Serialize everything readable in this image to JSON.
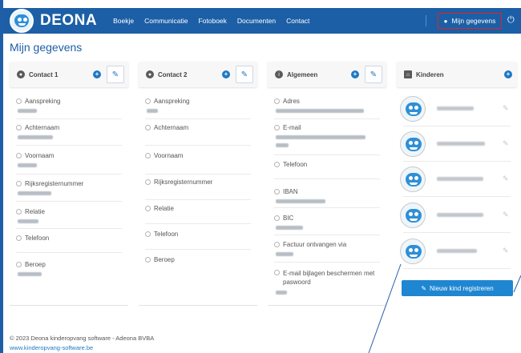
{
  "brand": "DEONA",
  "nav": {
    "links": [
      "Boekje",
      "Communicatie",
      "Fotoboek",
      "Documenten",
      "Contact"
    ],
    "user_label": "Mijn gegevens"
  },
  "page_title": "Mijn gegevens",
  "cards": {
    "contact1": {
      "title": "Contact 1",
      "fields": [
        "Aanspreking",
        "Achternaam",
        "Voornaam",
        "Rijksregisternummer",
        "Relatie",
        "Telefoon",
        "Beroep"
      ]
    },
    "contact2": {
      "title": "Contact 2",
      "fields": [
        "Aanspreking",
        "Achternaam",
        "Voornaam",
        "Rijksregisternummer",
        "Relatie",
        "Telefoon",
        "Beroep"
      ]
    },
    "algemeen": {
      "title": "Algemeen",
      "fields": [
        "Adres",
        "E-mail",
        "Telefoon",
        "IBAN",
        "BIC",
        "Factuur ontvangen via",
        "E-mail bijlagen beschermen met paswoord"
      ]
    },
    "kinderen": {
      "title": "Kinderen",
      "register_label": "Nieuw kind registreren"
    }
  },
  "icons": {
    "user": "user-icon",
    "power": "power-icon",
    "plus": "plus-circle-icon",
    "edit": "pencil-icon",
    "info": "info-icon",
    "home": "home-icon"
  },
  "footer": {
    "copyright": "© 2023 Deona kinderopvang software - Adeona BVBA",
    "website": "www.kinderopvang-software.be"
  },
  "colors": {
    "navbar": "#1c5fa6",
    "accent": "#1f78c4",
    "button": "#1f86d1",
    "highlight_border": "#e02424"
  }
}
